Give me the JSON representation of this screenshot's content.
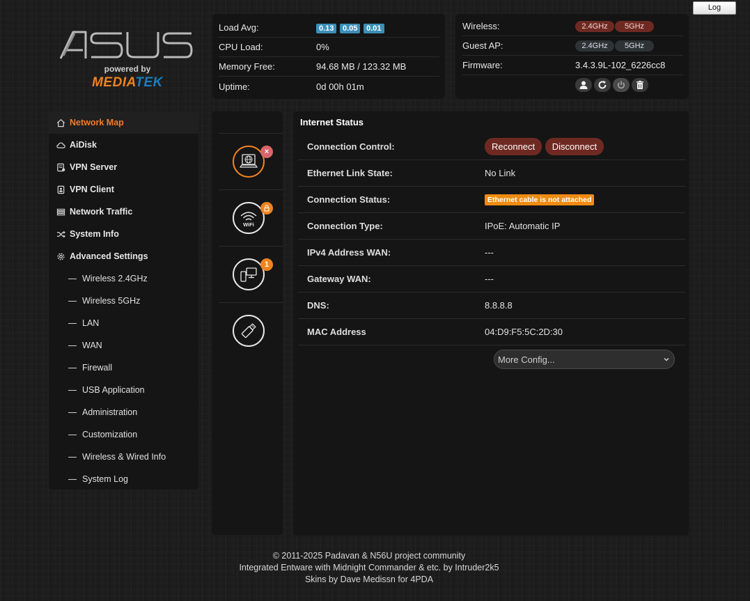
{
  "header": {
    "log_label": "Log",
    "logo": {
      "brand": "ASUS",
      "powered_by": "powered by",
      "partner_part1": "MEDIA",
      "partner_part2": "TEK"
    }
  },
  "stats": {
    "load_avg": {
      "label": "Load Avg:",
      "values": [
        "0.13",
        "0.05",
        "0.01"
      ]
    },
    "cpu_load": {
      "label": "CPU Load:",
      "value": "0%"
    },
    "memory_free": {
      "label": "Memory Free:",
      "value": "94.68 MB / 123.32 MB"
    },
    "uptime": {
      "label": "Uptime:",
      "value": "0d 00h 01m"
    }
  },
  "wireless": {
    "wireless": {
      "label": "Wireless:",
      "band1": "2.4GHz",
      "band2": "5GHz"
    },
    "guest_ap": {
      "label": "Guest AP:",
      "band1": "2.4GHz",
      "band2": "5GHz"
    },
    "firmware": {
      "label": "Firmware:",
      "value": "3.4.3.9L-102_6226cc8"
    },
    "actions": [
      "user-icon",
      "refresh-icon",
      "power-icon",
      "trash-icon"
    ]
  },
  "sidebar": {
    "items": [
      {
        "label": "Network Map",
        "icon": "home-icon",
        "active": true
      },
      {
        "label": "AiDisk",
        "icon": "cloud-icon"
      },
      {
        "label": "VPN Server",
        "icon": "vpn-server-icon"
      },
      {
        "label": "VPN Client",
        "icon": "vpn-client-icon"
      },
      {
        "label": "Network Traffic",
        "icon": "traffic-icon"
      },
      {
        "label": "System Info",
        "icon": "shuffle-icon"
      },
      {
        "label": "Advanced Settings",
        "icon": "gear-icon"
      }
    ],
    "sub_items": [
      "Wireless 2.4GHz",
      "Wireless 5GHz",
      "LAN",
      "WAN",
      "Firewall",
      "USB Application",
      "Administration",
      "Customization",
      "Wireless & Wired Info",
      "System Log"
    ]
  },
  "map_icons": {
    "internet": {
      "icon": "internet-globe-icon",
      "badge": "×"
    },
    "wifi": {
      "icon": "wifi-icon",
      "badge_icon": "lock-icon",
      "label": "WiFi"
    },
    "clients": {
      "icon": "clients-icon",
      "badge": "1"
    },
    "usb": {
      "icon": "usb-icon"
    }
  },
  "internet_status": {
    "title": "Internet Status",
    "rows": [
      {
        "label": "Connection Control:",
        "buttons": [
          "Reconnect",
          "Disconnect"
        ]
      },
      {
        "label": "Ethernet Link State:",
        "value": "No Link"
      },
      {
        "label": "Connection Status:",
        "warning": "Ethernet cable is not attached"
      },
      {
        "label": "Connection Type:",
        "value": "IPoE: Automatic IP"
      },
      {
        "label": "IPv4 Address WAN:",
        "value": "---"
      },
      {
        "label": "Gateway WAN:",
        "value": "---"
      },
      {
        "label": "DNS:",
        "value": "8.8.8.8"
      },
      {
        "label": "MAC Address",
        "value": "04:D9:F5:5C:2D:30"
      }
    ],
    "more_config": "More Config..."
  },
  "colors": {
    "accent_orange": "#f0831f",
    "load_badge_blue": "#3b8fb8",
    "pill_red": "#6e2a22",
    "warning_orange": "#ef8b12"
  },
  "footer": {
    "line1": "© 2011-2025 Padavan & N56U project community",
    "line2": "Integrated Entware with Midnight Commander & etc. by Intruder2k5",
    "line3": "Skins by Dave Medissn for 4PDA"
  }
}
